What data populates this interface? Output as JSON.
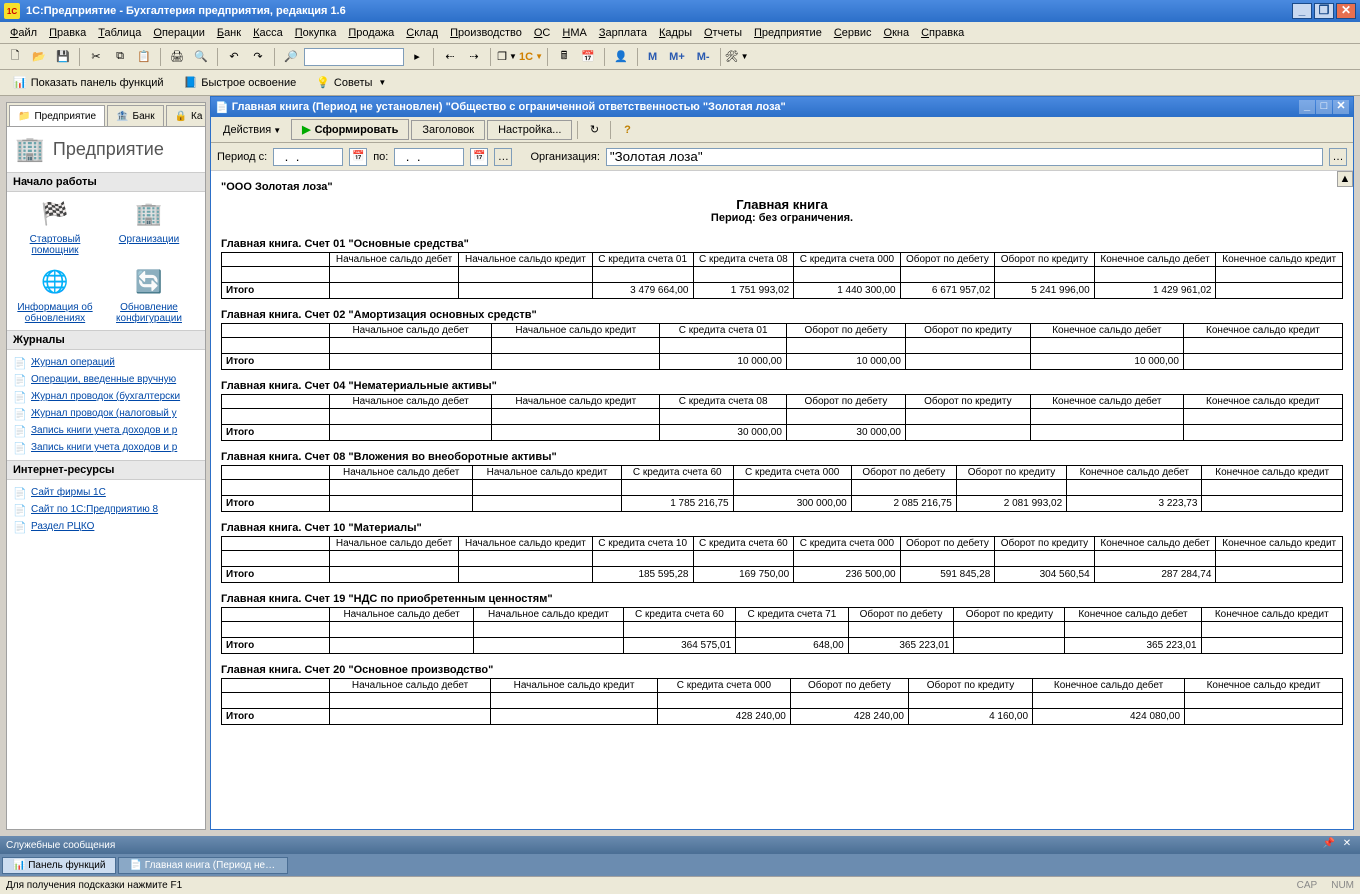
{
  "titlebar": {
    "text": "1С:Предприятие - Бухгалтерия предприятия, редакция 1.6"
  },
  "menu": [
    "Файл",
    "Правка",
    "Таблица",
    "Операции",
    "Банк",
    "Касса",
    "Покупка",
    "Продажа",
    "Склад",
    "Производство",
    "ОС",
    "НМА",
    "Зарплата",
    "Кадры",
    "Отчеты",
    "Предприятие",
    "Сервис",
    "Окна",
    "Справка"
  ],
  "tb2": {
    "m": "М",
    "mplus": "М+",
    "mminus": "М-"
  },
  "tb3": {
    "panel": "Показать панель функций",
    "quick": "Быстрое освоение",
    "tips": "Советы"
  },
  "leftpanel": {
    "tabs": [
      "Предприятие",
      "Банк",
      "Ка"
    ],
    "heading": "Предприятие",
    "section_start": "Начало работы",
    "items": [
      {
        "label": "Стартовый помощник",
        "icon": "🏁"
      },
      {
        "label": "Организации",
        "icon": "🏢"
      },
      {
        "label": "Информация об обновлениях",
        "icon": "🌐"
      },
      {
        "label": "Обновление конфигурации",
        "icon": "🔄"
      }
    ],
    "section_journals": "Журналы",
    "journals": [
      "Журнал операций",
      "Операции, введенные вручную",
      "Журнал проводок (бухгалтерски",
      "Журнал проводок (налоговый у",
      "Запись книги учета доходов и р",
      "Запись книги учета доходов и р"
    ],
    "section_inet": "Интернет-ресурсы",
    "inet": [
      "Сайт фирмы 1С",
      "Сайт по 1С:Предприятию 8",
      "Раздел РЦКО"
    ]
  },
  "subwin": {
    "title": "Главная книга (Период не установлен) \"Общество с ограниченной ответственностью \"Золотая лоза\"",
    "actions": "Действия",
    "form": "Сформировать",
    "header_btn": "Заголовок",
    "settings": "Настройка...",
    "period_label": "Период с:",
    "period_to": "по:",
    "org_label": "Организация:",
    "org_value": "\"Золотая лоза\"",
    "org_name": "\"ООО Золотая лоза\"",
    "rep_title": "Главная книга",
    "rep_sub": "Период: без ограничения.",
    "sections": [
      {
        "title": "Главная книга. Счет 01 \"Основные средства\"",
        "headers": [
          "",
          "Начальное сальдо дебет",
          "Начальное сальдо кредит",
          "С кредита счета 01",
          "С кредита счета 08",
          "С кредита счета 000",
          "Оборот по дебету",
          "Оборот по кредиту",
          "Конечное сальдо дебет",
          "Конечное сальдо кредит"
        ],
        "row": [
          "Итого",
          "",
          "",
          "3 479 664,00",
          "1 751 993,02",
          "1 440 300,00",
          "6 671 957,02",
          "5 241 996,00",
          "1 429 961,02",
          ""
        ]
      },
      {
        "title": "Главная книга. Счет 02 \"Амортизация основных средств\"",
        "headers": [
          "",
          "Начальное сальдо дебет",
          "Начальное сальдо кредит",
          "С кредита счета 01",
          "Оборот по дебету",
          "Оборот по кредиту",
          "Конечное сальдо дебет",
          "Конечное сальдо кредит"
        ],
        "row": [
          "Итого",
          "",
          "",
          "10 000,00",
          "10 000,00",
          "",
          "10 000,00",
          ""
        ]
      },
      {
        "title": "Главная книга. Счет 04 \"Нематериальные активы\"",
        "headers": [
          "",
          "Начальное сальдо дебет",
          "Начальное сальдо кредит",
          "С кредита счета 08",
          "Оборот по дебету",
          "Оборот по кредиту",
          "Конечное сальдо дебет",
          "Конечное сальдо кредит"
        ],
        "row": [
          "Итого",
          "",
          "",
          "30 000,00",
          "30 000,00",
          "",
          "",
          ""
        ]
      },
      {
        "title": "Главная книга. Счет 08 \"Вложения во внеоборотные активы\"",
        "headers": [
          "",
          "Начальное сальдо дебет",
          "Начальное сальдо кредит",
          "С кредита счета 60",
          "С кредита счета 000",
          "Оборот по дебету",
          "Оборот по кредиту",
          "Конечное сальдо дебет",
          "Конечное сальдо кредит"
        ],
        "row": [
          "Итого",
          "",
          "",
          "1 785 216,75",
          "300 000,00",
          "2 085 216,75",
          "2 081 993,02",
          "3 223,73",
          ""
        ]
      },
      {
        "title": "Главная книга. Счет 10 \"Материалы\"",
        "headers": [
          "",
          "Начальное сальдо дебет",
          "Начальное сальдо кредит",
          "С кредита счета 10",
          "С кредита счета 60",
          "С кредита счета 000",
          "Оборот по дебету",
          "Оборот по кредиту",
          "Конечное сальдо дебет",
          "Конечное сальдо кредит"
        ],
        "row": [
          "Итого",
          "",
          "",
          "185 595,28",
          "169 750,00",
          "236 500,00",
          "591 845,28",
          "304 560,54",
          "287 284,74",
          ""
        ]
      },
      {
        "title": "Главная книга. Счет 19 \"НДС по приобретенным ценностям\"",
        "headers": [
          "",
          "Начальное сальдо дебет",
          "Начальное сальдо кредит",
          "С кредита счета 60",
          "С кредита счета 71",
          "Оборот по дебету",
          "Оборот по кредиту",
          "Конечное сальдо дебет",
          "Конечное сальдо кредит"
        ],
        "row": [
          "Итого",
          "",
          "",
          "364 575,01",
          "648,00",
          "365 223,01",
          "",
          "365 223,01",
          ""
        ]
      },
      {
        "title": "Главная книга. Счет 20 \"Основное производство\"",
        "headers": [
          "",
          "Начальное сальдо дебет",
          "Начальное сальдо кредит",
          "С кредита счета 000",
          "Оборот по дебету",
          "Оборот по кредиту",
          "Конечное сальдо дебет",
          "Конечное сальдо кредит"
        ],
        "row": [
          "Итого",
          "",
          "",
          "428 240,00",
          "428 240,00",
          "4 160,00",
          "424 080,00",
          ""
        ]
      }
    ]
  },
  "msgbar": "Служебные сообщения",
  "tasks": [
    "Панель функций",
    "Главная книга (Период не у..."
  ],
  "status": {
    "hint": "Для получения подсказки нажмите F1",
    "cap": "CAP",
    "num": "NUM"
  }
}
